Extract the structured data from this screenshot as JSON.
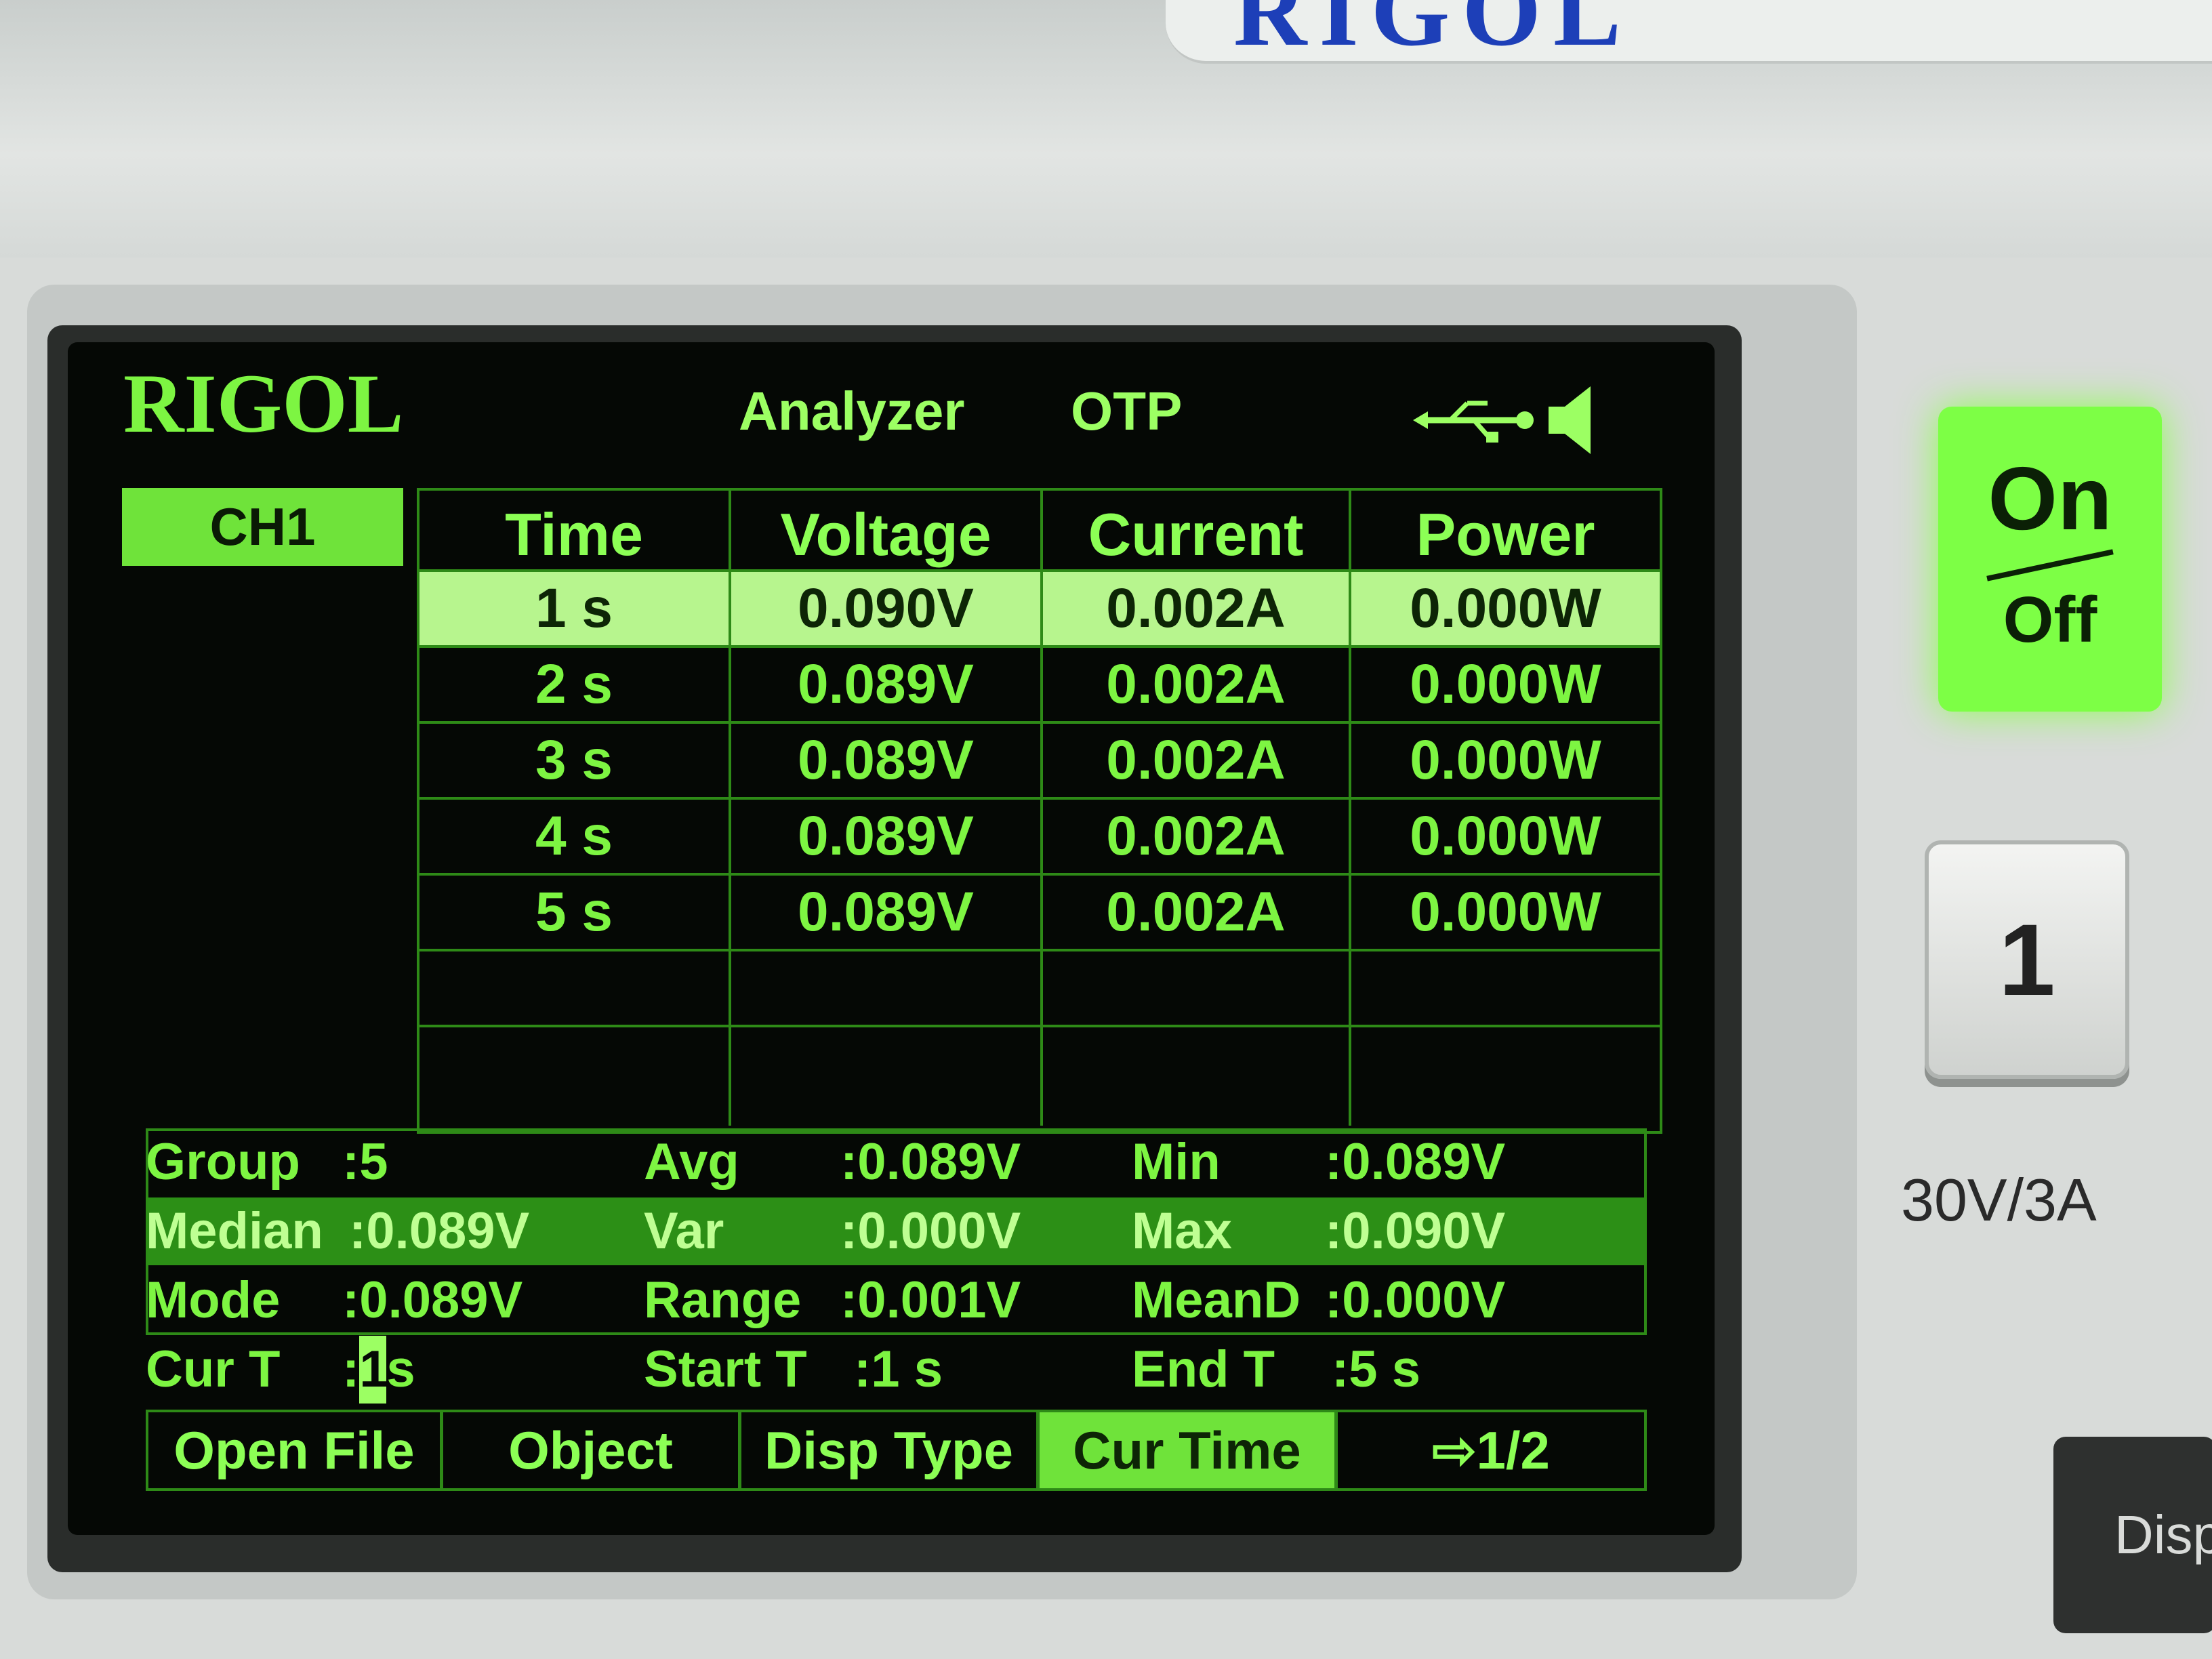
{
  "device": {
    "brand": "RIGOL",
    "onoff_on": "On",
    "onoff_off": "Off",
    "channel_button": "1",
    "range_label": "30V/3A",
    "disp_button": "Disp"
  },
  "topbar": {
    "logo": "RIGOL",
    "mode": "Analyzer",
    "protection": "OTP"
  },
  "channel_tab": "CH1",
  "table": {
    "headers": [
      "Time",
      "Voltage",
      "Current",
      "Power"
    ],
    "rows": [
      [
        "1 s",
        "0.090V",
        "0.002A",
        "0.000W"
      ],
      [
        "2 s",
        "0.089V",
        "0.002A",
        "0.000W"
      ],
      [
        "3 s",
        "0.089V",
        "0.002A",
        "0.000W"
      ],
      [
        "4 s",
        "0.089V",
        "0.002A",
        "0.000W"
      ],
      [
        "5 s",
        "0.089V",
        "0.002A",
        "0.000W"
      ]
    ],
    "selected_row": 0
  },
  "stats": {
    "group_label": "Group",
    "group_value": ":5",
    "avg_label": "Avg",
    "avg_value": ":0.089V",
    "min_label": "Min",
    "min_value": ":0.089V",
    "median_label": "Median",
    "median_value": ":0.089V",
    "var_label": "Var",
    "var_value": ":0.000V",
    "max_label": "Max",
    "max_value": ":0.090V",
    "mode_label": "Mode",
    "mode_value": ":0.089V",
    "range_label": "Range",
    "range_value": ":0.001V",
    "meand_label": "MeanD",
    "meand_value": ":0.000V",
    "curt_label": "Cur T",
    "curt_prefix": ":",
    "curt_value": "1",
    "curt_unit": "s",
    "startt_label": "Start T",
    "startt_value": ":1 s",
    "endt_label": "End T",
    "endt_value": ":5 s"
  },
  "softkeys": {
    "items": [
      "Open File",
      "Object",
      "Disp Type",
      "Cur Time",
      "⇨1/2"
    ],
    "active_index": 3
  },
  "colors": {
    "lcd_green": "#7df542",
    "lcd_background": "#050805",
    "brand_blue": "#1d3fb8",
    "onoff_green": "#7dff45"
  }
}
